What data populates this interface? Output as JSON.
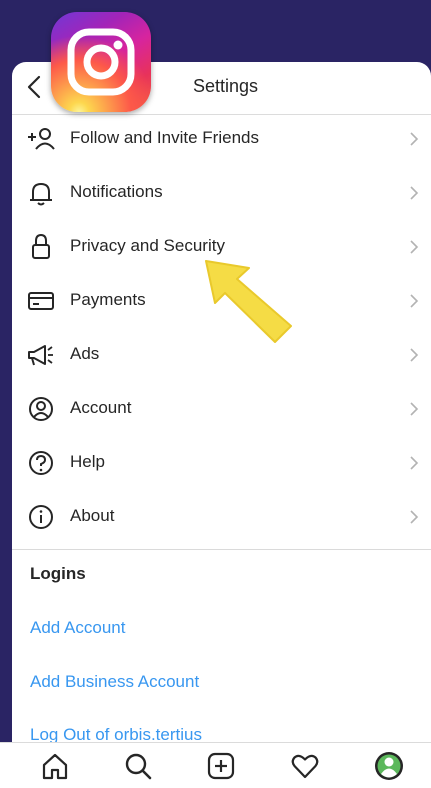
{
  "header": {
    "title": "Settings"
  },
  "menu": {
    "items": [
      {
        "label": "Follow and Invite Friends",
        "icon": "add-person-icon"
      },
      {
        "label": "Notifications",
        "icon": "bell-icon"
      },
      {
        "label": "Privacy and Security",
        "icon": "lock-icon"
      },
      {
        "label": "Payments",
        "icon": "card-icon"
      },
      {
        "label": "Ads",
        "icon": "megaphone-icon"
      },
      {
        "label": "Account",
        "icon": "account-icon"
      },
      {
        "label": "Help",
        "icon": "help-icon"
      },
      {
        "label": "About",
        "icon": "info-icon"
      }
    ]
  },
  "logins": {
    "title": "Logins",
    "add_account": "Add Account",
    "add_business_account": "Add Business Account",
    "log_out": "Log Out of orbis.tertius"
  },
  "tabbar": {
    "tabs": [
      "home-icon",
      "search-icon",
      "new-post-icon",
      "heart-icon",
      "profile-avatar-icon"
    ]
  },
  "colors": {
    "background": "#2a2464",
    "link": "#3897f0",
    "text": "#262626",
    "arrow": "#f5dc45"
  }
}
